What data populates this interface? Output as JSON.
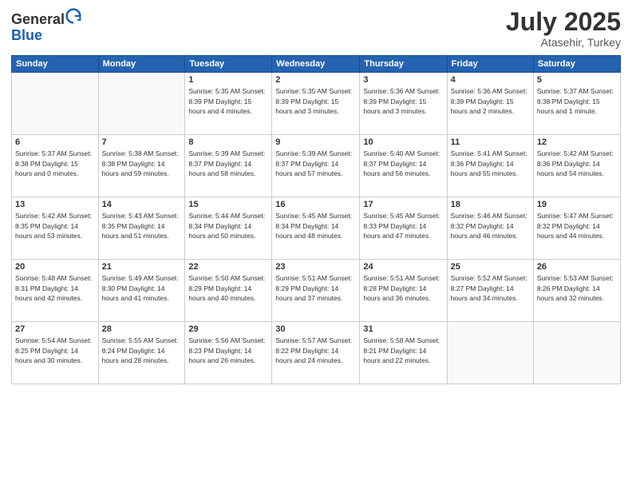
{
  "header": {
    "logo_line1": "General",
    "logo_line2": "Blue",
    "month": "July 2025",
    "location": "Atasehir, Turkey"
  },
  "weekdays": [
    "Sunday",
    "Monday",
    "Tuesday",
    "Wednesday",
    "Thursday",
    "Friday",
    "Saturday"
  ],
  "weeks": [
    [
      {
        "day": "",
        "info": ""
      },
      {
        "day": "",
        "info": ""
      },
      {
        "day": "1",
        "info": "Sunrise: 5:35 AM\nSunset: 8:39 PM\nDaylight: 15 hours\nand 4 minutes."
      },
      {
        "day": "2",
        "info": "Sunrise: 5:35 AM\nSunset: 8:39 PM\nDaylight: 15 hours\nand 3 minutes."
      },
      {
        "day": "3",
        "info": "Sunrise: 5:36 AM\nSunset: 8:39 PM\nDaylight: 15 hours\nand 3 minutes."
      },
      {
        "day": "4",
        "info": "Sunrise: 5:36 AM\nSunset: 8:39 PM\nDaylight: 15 hours\nand 2 minutes."
      },
      {
        "day": "5",
        "info": "Sunrise: 5:37 AM\nSunset: 8:38 PM\nDaylight: 15 hours\nand 1 minute."
      }
    ],
    [
      {
        "day": "6",
        "info": "Sunrise: 5:37 AM\nSunset: 8:38 PM\nDaylight: 15 hours\nand 0 minutes."
      },
      {
        "day": "7",
        "info": "Sunrise: 5:38 AM\nSunset: 8:38 PM\nDaylight: 14 hours\nand 59 minutes."
      },
      {
        "day": "8",
        "info": "Sunrise: 5:39 AM\nSunset: 8:37 PM\nDaylight: 14 hours\nand 58 minutes."
      },
      {
        "day": "9",
        "info": "Sunrise: 5:39 AM\nSunset: 8:37 PM\nDaylight: 14 hours\nand 57 minutes."
      },
      {
        "day": "10",
        "info": "Sunrise: 5:40 AM\nSunset: 8:37 PM\nDaylight: 14 hours\nand 56 minutes."
      },
      {
        "day": "11",
        "info": "Sunrise: 5:41 AM\nSunset: 8:36 PM\nDaylight: 14 hours\nand 55 minutes."
      },
      {
        "day": "12",
        "info": "Sunrise: 5:42 AM\nSunset: 8:36 PM\nDaylight: 14 hours\nand 54 minutes."
      }
    ],
    [
      {
        "day": "13",
        "info": "Sunrise: 5:42 AM\nSunset: 8:35 PM\nDaylight: 14 hours\nand 53 minutes."
      },
      {
        "day": "14",
        "info": "Sunrise: 5:43 AM\nSunset: 8:35 PM\nDaylight: 14 hours\nand 51 minutes."
      },
      {
        "day": "15",
        "info": "Sunrise: 5:44 AM\nSunset: 8:34 PM\nDaylight: 14 hours\nand 50 minutes."
      },
      {
        "day": "16",
        "info": "Sunrise: 5:45 AM\nSunset: 8:34 PM\nDaylight: 14 hours\nand 48 minutes."
      },
      {
        "day": "17",
        "info": "Sunrise: 5:45 AM\nSunset: 8:33 PM\nDaylight: 14 hours\nand 47 minutes."
      },
      {
        "day": "18",
        "info": "Sunrise: 5:46 AM\nSunset: 8:32 PM\nDaylight: 14 hours\nand 46 minutes."
      },
      {
        "day": "19",
        "info": "Sunrise: 5:47 AM\nSunset: 8:32 PM\nDaylight: 14 hours\nand 44 minutes."
      }
    ],
    [
      {
        "day": "20",
        "info": "Sunrise: 5:48 AM\nSunset: 8:31 PM\nDaylight: 14 hours\nand 42 minutes."
      },
      {
        "day": "21",
        "info": "Sunrise: 5:49 AM\nSunset: 8:30 PM\nDaylight: 14 hours\nand 41 minutes."
      },
      {
        "day": "22",
        "info": "Sunrise: 5:50 AM\nSunset: 8:29 PM\nDaylight: 14 hours\nand 40 minutes."
      },
      {
        "day": "23",
        "info": "Sunrise: 5:51 AM\nSunset: 8:29 PM\nDaylight: 14 hours\nand 37 minutes."
      },
      {
        "day": "24",
        "info": "Sunrise: 5:51 AM\nSunset: 8:28 PM\nDaylight: 14 hours\nand 36 minutes."
      },
      {
        "day": "25",
        "info": "Sunrise: 5:52 AM\nSunset: 8:27 PM\nDaylight: 14 hours\nand 34 minutes."
      },
      {
        "day": "26",
        "info": "Sunrise: 5:53 AM\nSunset: 8:26 PM\nDaylight: 14 hours\nand 32 minutes."
      }
    ],
    [
      {
        "day": "27",
        "info": "Sunrise: 5:54 AM\nSunset: 8:25 PM\nDaylight: 14 hours\nand 30 minutes."
      },
      {
        "day": "28",
        "info": "Sunrise: 5:55 AM\nSunset: 8:24 PM\nDaylight: 14 hours\nand 28 minutes."
      },
      {
        "day": "29",
        "info": "Sunrise: 5:56 AM\nSunset: 8:23 PM\nDaylight: 14 hours\nand 26 minutes."
      },
      {
        "day": "30",
        "info": "Sunrise: 5:57 AM\nSunset: 8:22 PM\nDaylight: 14 hours\nand 24 minutes."
      },
      {
        "day": "31",
        "info": "Sunrise: 5:58 AM\nSunset: 8:21 PM\nDaylight: 14 hours\nand 22 minutes."
      },
      {
        "day": "",
        "info": ""
      },
      {
        "day": "",
        "info": ""
      }
    ]
  ]
}
